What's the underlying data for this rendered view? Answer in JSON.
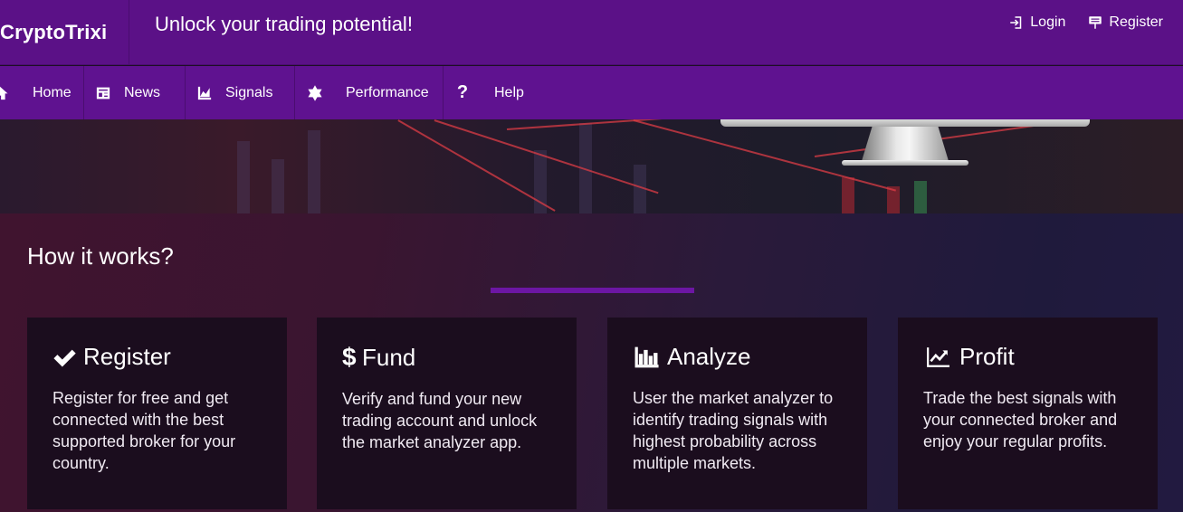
{
  "header": {
    "brand": "CryptoTrixi",
    "tagline": "Unlock your trading potential!",
    "login_label": "Login",
    "register_label": "Register"
  },
  "nav": {
    "items": [
      {
        "label": "Home",
        "icon": "home-icon"
      },
      {
        "label": "News",
        "icon": "newspaper-icon"
      },
      {
        "label": "Signals",
        "icon": "area-chart-icon"
      },
      {
        "label": "Performance",
        "icon": "star-of-david-icon"
      },
      {
        "label": "Help",
        "icon": "question-icon"
      }
    ]
  },
  "how": {
    "title": "How it works?",
    "cards": [
      {
        "title": "Register",
        "icon": "check-icon",
        "text": "Register for free and get connected with the best supported broker for your country."
      },
      {
        "title": "Fund",
        "icon": "dollar-icon",
        "text": "Verify and fund your new trading account and unlock the market analyzer app."
      },
      {
        "title": "Analyze",
        "icon": "bar-chart-icon",
        "text": "User the market analyzer to identify trading signals with highest probability across multiple markets."
      },
      {
        "title": "Profit",
        "icon": "line-chart-icon",
        "text": "Trade the best signals with your connected broker and enjoy your regular profits."
      }
    ]
  },
  "colors": {
    "header_bg": "#5b1187",
    "nav_bg": "#5f1290",
    "accent": "#6c16a3",
    "card_bg": "#1b0d1e"
  }
}
